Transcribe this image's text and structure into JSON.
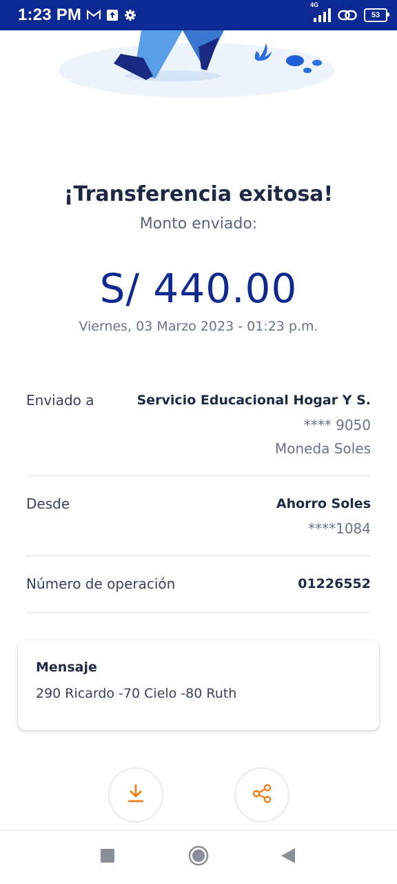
{
  "status_bar": {
    "time": "1:23 PM",
    "network": "4G",
    "battery": "53",
    "icons": [
      "gmail-icon",
      "upload-notification-icon",
      "settings-icon",
      "signal-icon",
      "link-icon",
      "battery-icon"
    ]
  },
  "header": {
    "title": "¡Transferencia exitosa!",
    "subtitle": "Monto enviado:",
    "amount": "S/ 440.00",
    "datetime": "Viernes, 03 Marzo 2023 - 01:23 p.m."
  },
  "details": {
    "sent_to": {
      "label": "Enviado a",
      "name": "Servicio Educacional Hogar Y S.",
      "account": "**** 9050",
      "currency": "Moneda Soles"
    },
    "from": {
      "label": "Desde",
      "account_name": "Ahorro Soles",
      "account": "****1084"
    },
    "operation": {
      "label": "Número de operación",
      "number": "01226552"
    }
  },
  "message": {
    "title": "Mensaje",
    "text": "290 Ricardo -70 Cielo -80 Ruth"
  },
  "actions": {
    "download_icon": "download-icon",
    "share_icon": "share-icon"
  },
  "colors": {
    "status_bar": "#0d2a94",
    "amount": "#11298f",
    "accent_orange": "#f07d1a"
  }
}
